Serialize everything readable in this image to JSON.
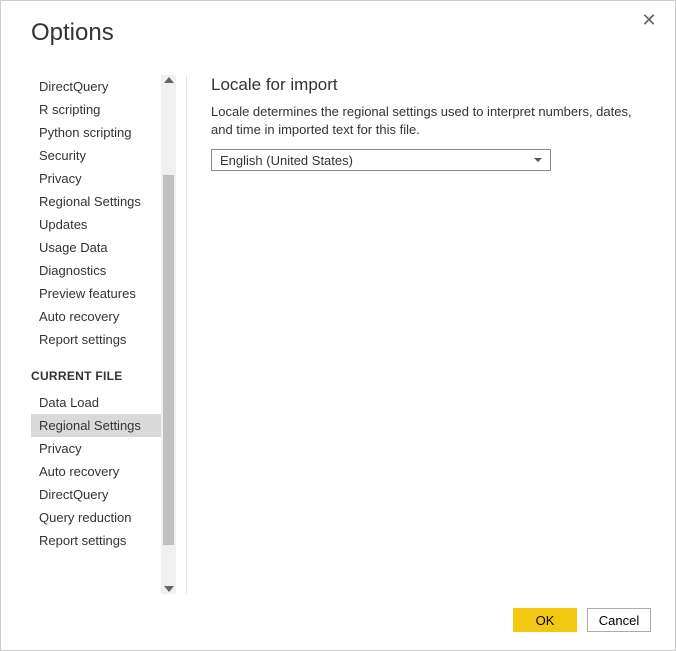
{
  "dialog": {
    "title": "Options",
    "ok_label": "OK",
    "cancel_label": "Cancel"
  },
  "sidebar": {
    "global_items": [
      "DirectQuery",
      "R scripting",
      "Python scripting",
      "Security",
      "Privacy",
      "Regional Settings",
      "Updates",
      "Usage Data",
      "Diagnostics",
      "Preview features",
      "Auto recovery",
      "Report settings"
    ],
    "section_header": "CURRENT FILE",
    "file_items": [
      "Data Load",
      "Regional Settings",
      "Privacy",
      "Auto recovery",
      "DirectQuery",
      "Query reduction",
      "Report settings"
    ],
    "selected_file_index": 1
  },
  "content": {
    "heading": "Locale for import",
    "description": "Locale determines the regional settings used to interpret numbers, dates, and time in imported text for this file.",
    "combo_value": "English (United States)"
  }
}
